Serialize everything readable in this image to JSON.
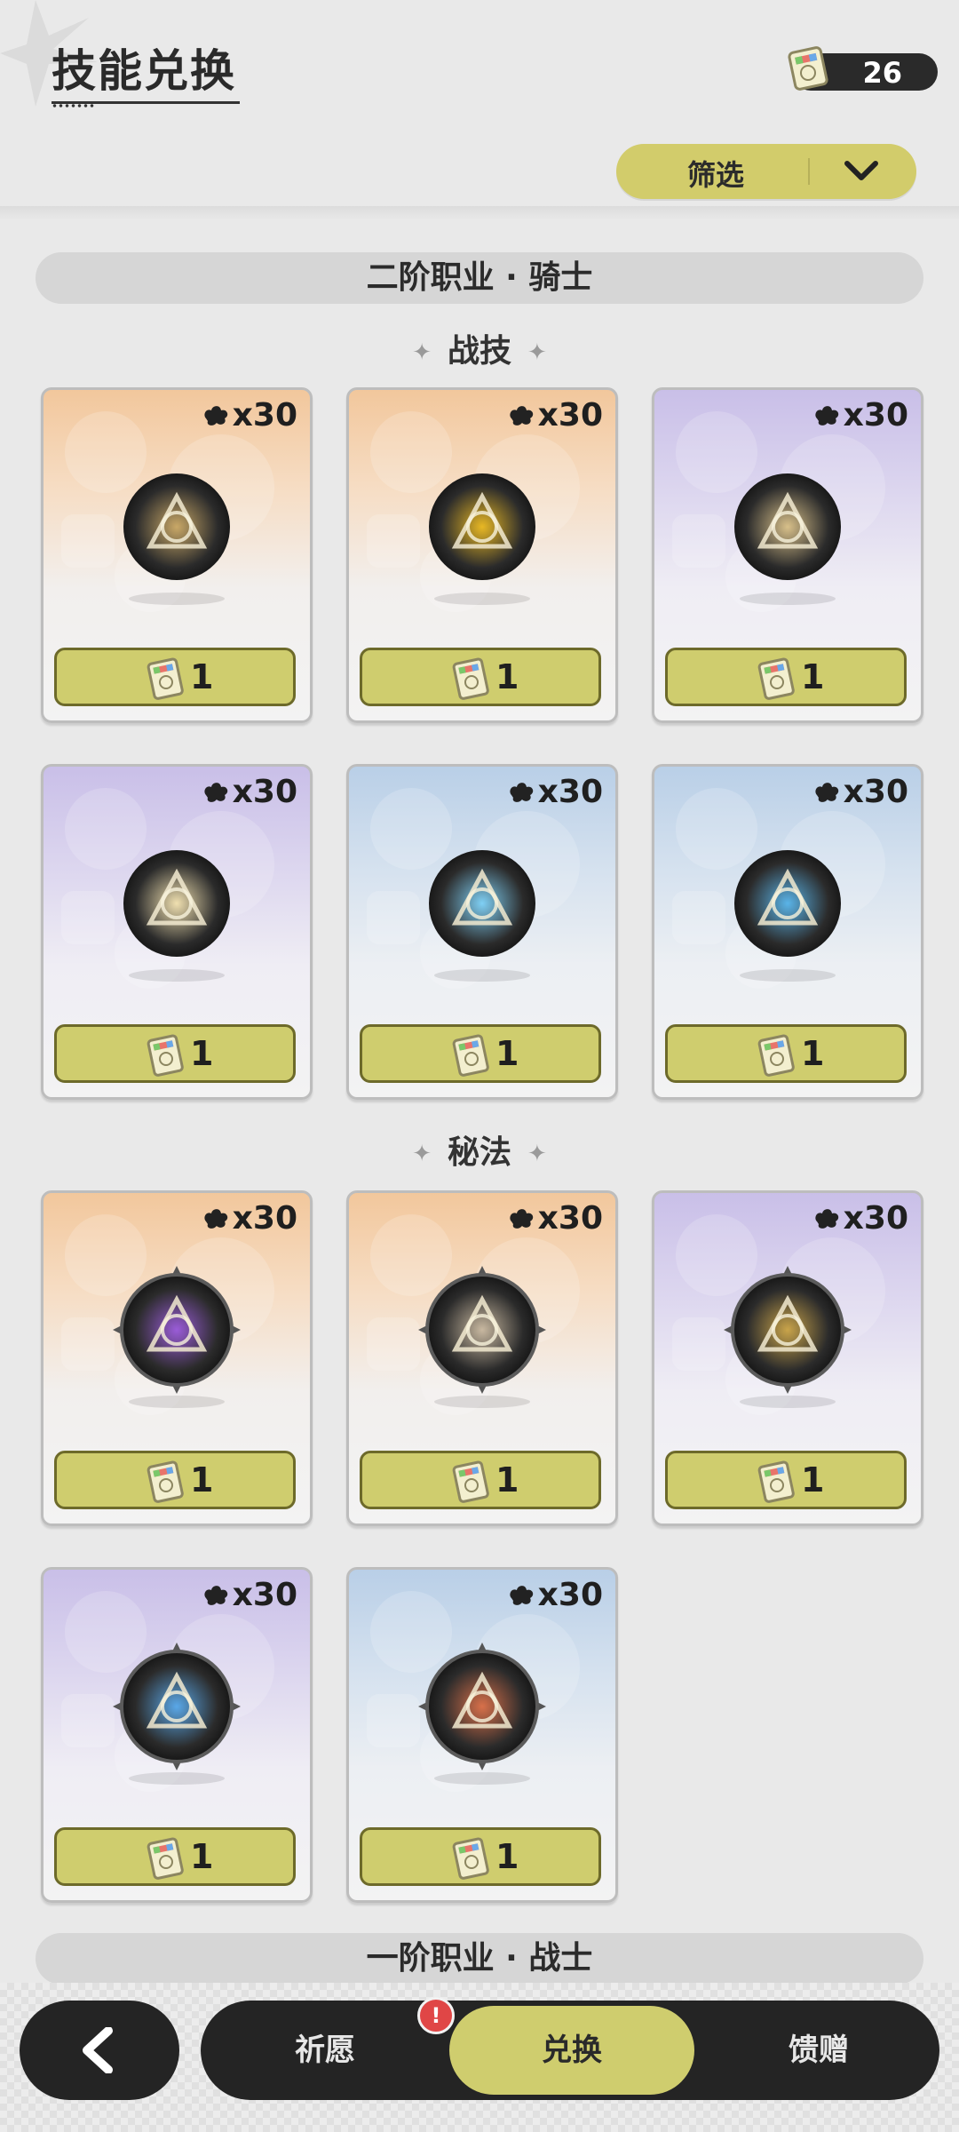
{
  "header": {
    "title": "技能兑换",
    "currency_value": "26",
    "currency_icon": "skill-ticket-icon"
  },
  "filter": {
    "label": "筛选",
    "icon": "chevron-down-icon"
  },
  "sections": [
    {
      "title": "二阶职业 · 骑士",
      "groups": [
        {
          "title": "战技",
          "cards": [
            {
              "count": "x30",
              "cost": "1",
              "theme": "orange",
              "icon": "shield-sword-skill-icon",
              "accent": "#c9a867"
            },
            {
              "count": "x30",
              "cost": "1",
              "theme": "orange",
              "icon": "golden-sigil-skill-icon",
              "accent": "#e8b824"
            },
            {
              "count": "x30",
              "cost": "1",
              "theme": "purple",
              "icon": "star-slash-skill-icon",
              "accent": "#d8c08a"
            },
            {
              "count": "x30",
              "cost": "1",
              "theme": "purple",
              "icon": "light-burst-skill-icon",
              "accent": "#f0e0b0"
            },
            {
              "count": "x30",
              "cost": "1",
              "theme": "blue",
              "icon": "ice-shatter-skill-icon",
              "accent": "#7fd0f5"
            },
            {
              "count": "x30",
              "cost": "1",
              "theme": "blue",
              "icon": "blue-aura-skill-icon",
              "accent": "#5ab4e8"
            }
          ]
        },
        {
          "title": "秘法",
          "cards": [
            {
              "count": "x30",
              "cost": "1",
              "theme": "orange",
              "icon": "purple-debuff-skill-icon",
              "accent": "#9a5cd8"
            },
            {
              "count": "x30",
              "cost": "1",
              "theme": "orange",
              "icon": "stone-strike-skill-icon",
              "accent": "#c8b8a0"
            },
            {
              "count": "x30",
              "cost": "1",
              "theme": "purple",
              "icon": "golden-spear-skill-icon",
              "accent": "#c9a44a"
            },
            {
              "count": "x30",
              "cost": "1",
              "theme": "purple",
              "icon": "blue-shield-skill-icon",
              "accent": "#5aa8e8"
            },
            {
              "count": "x30",
              "cost": "1",
              "theme": "blue",
              "icon": "red-shield-skill-icon",
              "accent": "#d8704a"
            }
          ]
        }
      ]
    },
    {
      "title": "一阶职业 · 战士"
    }
  ],
  "bottom_nav": {
    "back_icon": "back-arrow-icon",
    "tabs": [
      {
        "label": "祈愿",
        "active": false
      },
      {
        "label": "兑换",
        "active": true
      },
      {
        "label": "馈赠",
        "active": false
      }
    ],
    "badge": "!"
  },
  "colors": {
    "accent_yellow": "#cfcd6e",
    "dark": "#242424",
    "badge_red": "#e04646"
  }
}
